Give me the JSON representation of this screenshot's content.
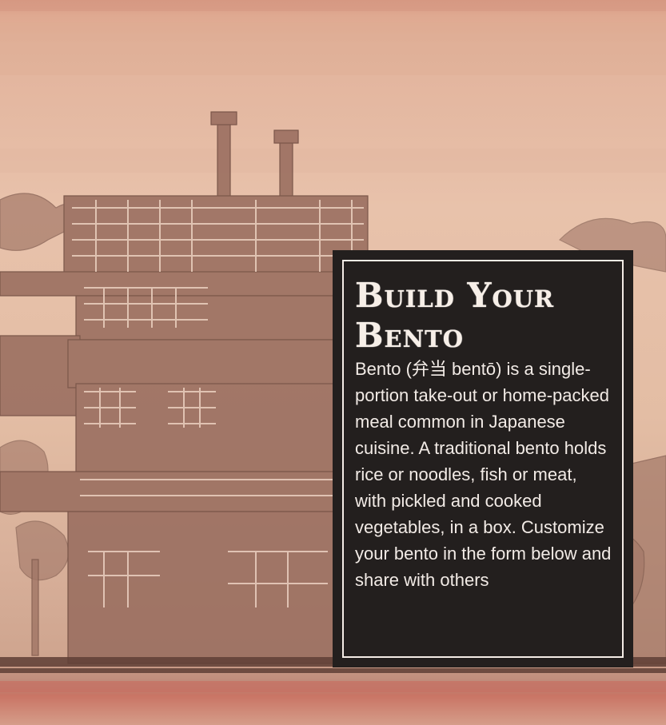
{
  "hero": {
    "background_image": "japanese-street-woodblock-illustration",
    "colors": {
      "sky_top": "#d99c84",
      "sky_mid": "#e8c2ab",
      "ink": "#8f6557",
      "card_bg": "#231f1e",
      "card_text": "#f2ebe6",
      "accent_red": "#c97464"
    }
  },
  "card": {
    "title": "Build Your Bento",
    "description": "Bento (弁当 bentō) is a single-portion take-out or home-packed meal common in Japanese cuisine. A traditional bento holds rice or noodles, fish or meat, with pickled and cooked vegetables, in a box. Customize your bento in the form below and share with others"
  }
}
